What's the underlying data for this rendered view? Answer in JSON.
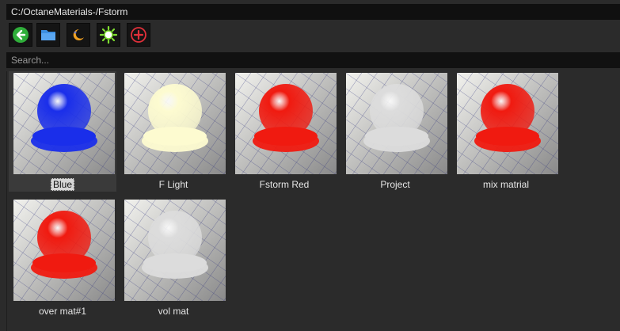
{
  "path": "C:/OctaneMaterials-/Fstorm",
  "toolbar": {
    "buttons": [
      {
        "icon": "back-arrow-icon",
        "color": "#2fae3a"
      },
      {
        "icon": "folder-icon",
        "color": "#3d8fe0"
      },
      {
        "icon": "moon-icon",
        "color": "#f0a020"
      },
      {
        "icon": "sun-icon",
        "color": "#7fe030"
      },
      {
        "icon": "add-icon",
        "color": "#e0303a"
      }
    ]
  },
  "search": {
    "placeholder": "Search..."
  },
  "materials": [
    {
      "label": "Blue",
      "color": "#1a2eea",
      "selected": true
    },
    {
      "label": "F Light",
      "color": "#fdfbd0"
    },
    {
      "label": "Fstorm Red",
      "color": "#f01a10"
    },
    {
      "label": "Project",
      "color": "#dcdcdc"
    },
    {
      "label": "mix matrial",
      "color": "#f01a10"
    },
    {
      "label": "over mat#1",
      "color": "#f01a10"
    },
    {
      "label": "vol mat",
      "color": "#dcdcdc"
    }
  ]
}
